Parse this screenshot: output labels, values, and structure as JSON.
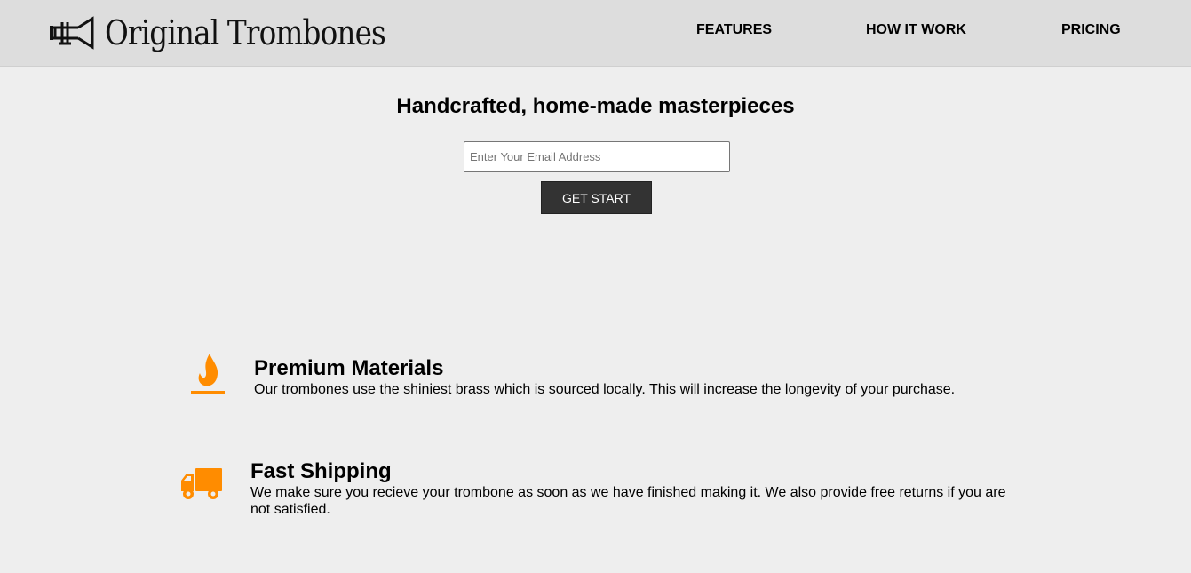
{
  "colors": {
    "header_bg": "#dddddd",
    "page_bg": "#eeeeee",
    "button_bg": "#333333",
    "accent_orange": "#ff8c00"
  },
  "header": {
    "logo_icon": "trombone-icon",
    "logo_text": "Original Trombones",
    "nav": [
      {
        "label": "FEATURES"
      },
      {
        "label": "HOW IT WORK"
      },
      {
        "label": "PRICING"
      }
    ]
  },
  "hero": {
    "title": "Handcrafted, home-made masterpieces",
    "email_placeholder": "Enter Your Email Address",
    "email_value": "",
    "button_label": "GET START"
  },
  "features": [
    {
      "icon": "fire-icon",
      "title": "Premium Materials",
      "description": "Our trombones use the shiniest brass which is sourced locally. This will increase the longevity of your purchase."
    },
    {
      "icon": "truck-icon",
      "title": "Fast Shipping",
      "description": "We make sure you recieve your trombone as soon as we have finished making it. We also provide free returns if you are not satisfied."
    }
  ]
}
